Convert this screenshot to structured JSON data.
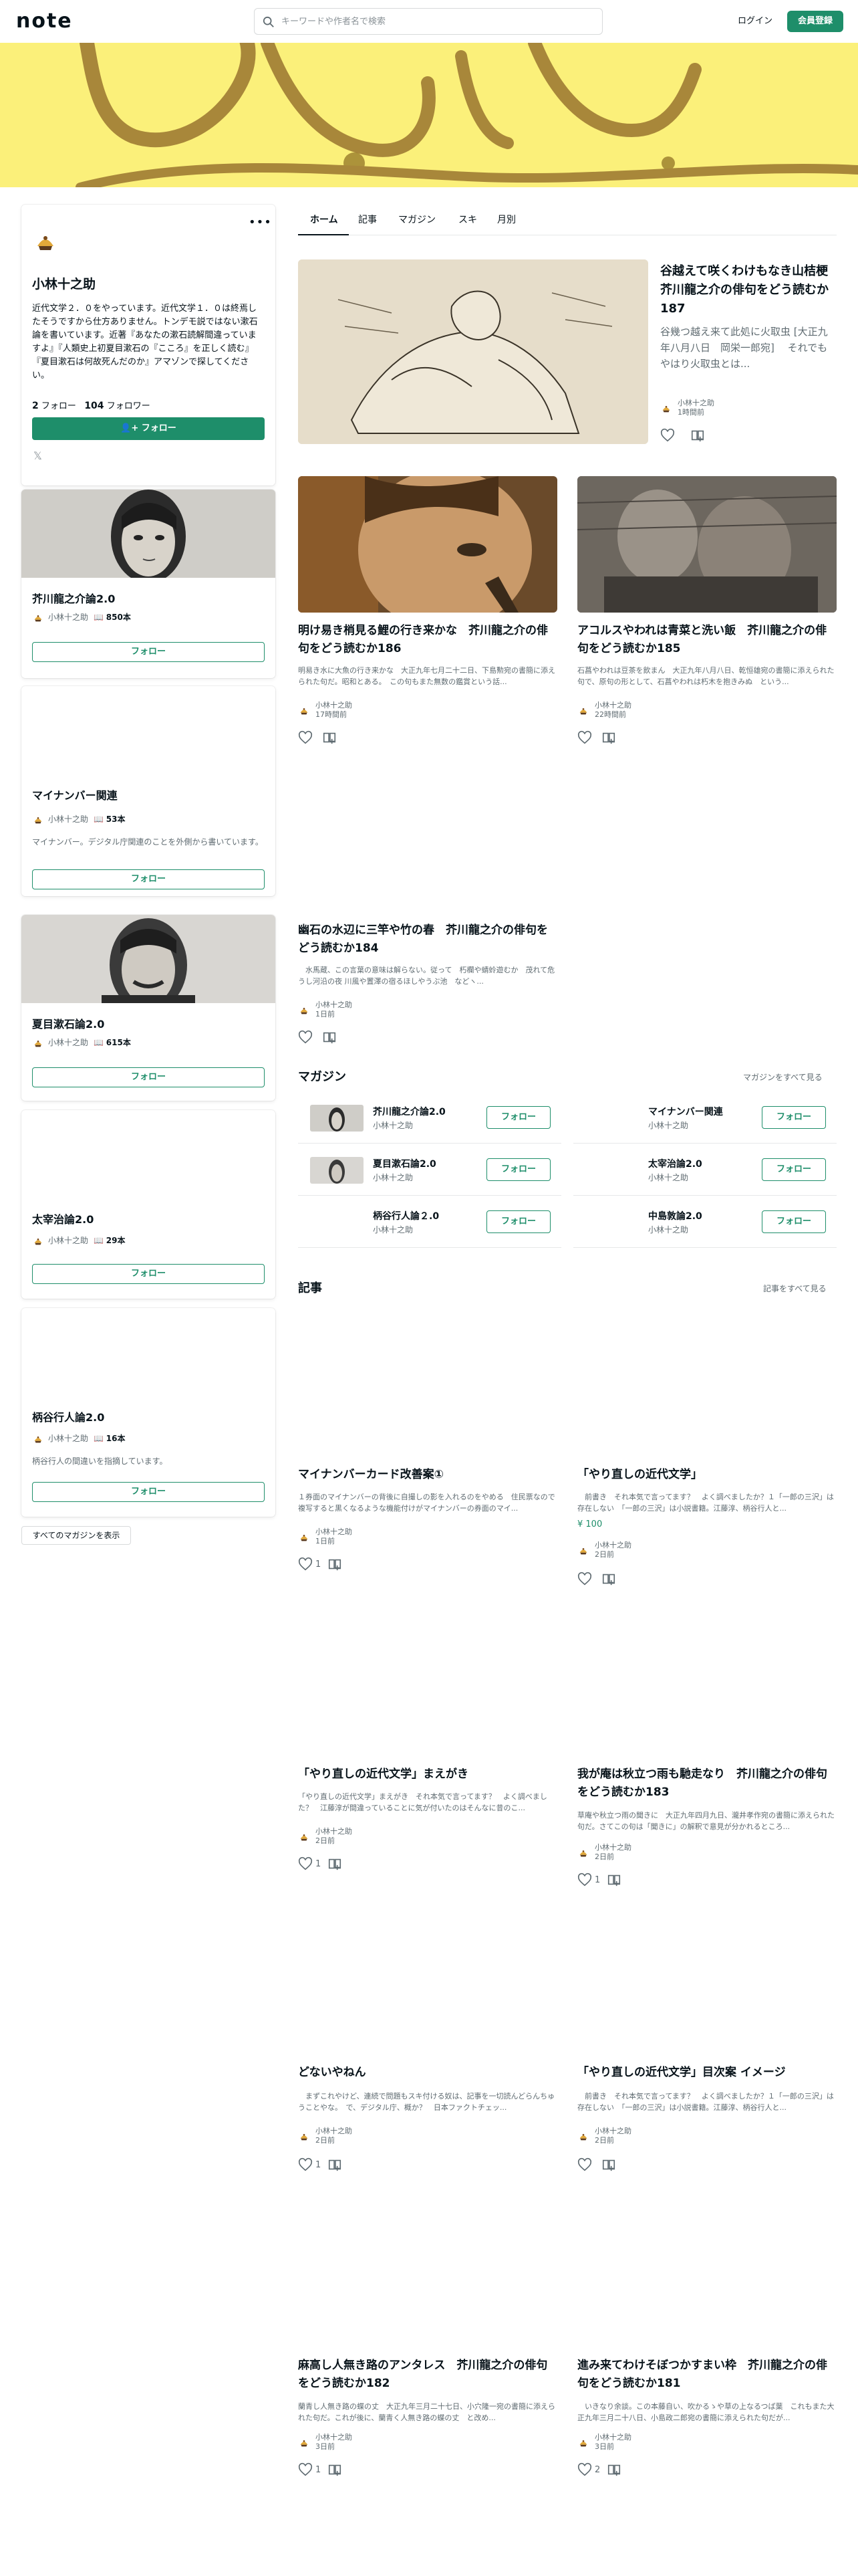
{
  "header": {
    "logo": "note",
    "search_placeholder": "キーワードや作者名で検索",
    "login": "ログイン",
    "signup": "会員登録"
  },
  "profile": {
    "name": "小林十之助",
    "bio": "近代文学２．０をやっています。近代文学１．０は終焉したそうですから仕方ありません。トンデモ説ではない漱石論を書いています。近著『あなたの漱石読解間違っていますよ』『人類史上初夏目漱石の『こころ』を正しく読む』『夏目漱石は何故死んだのか』アマゾンで探してください。",
    "following_count": "2",
    "following_label": "フォロー",
    "followers_count": "104",
    "followers_label": "フォロワー",
    "follow_button": "フォロー"
  },
  "sidebar_magazines": [
    {
      "title": "芥川龍之介論2.0",
      "author": "小林十之助",
      "count": "850本",
      "description": "",
      "follow": "フォロー"
    },
    {
      "title": "マイナンバー関連",
      "author": "小林十之助",
      "count": "53本",
      "description": "マイナンバー。デジタル庁関連のことを外側から書いています。",
      "follow": "フォロー"
    },
    {
      "title": "夏目漱石論2.0",
      "author": "小林十之助",
      "count": "615本",
      "description": "",
      "follow": "フォロー"
    },
    {
      "title": "太宰治論2.0",
      "author": "小林十之助",
      "count": "29本",
      "description": "",
      "follow": "フォロー"
    },
    {
      "title": "柄谷行人論2.0",
      "author": "小林十之助",
      "count": "16本",
      "description": "柄谷行人の間違いを指摘しています。",
      "follow": "フォロー"
    }
  ],
  "all_magazines_button": "すべてのマガジンを表示",
  "tabs": [
    "ホーム",
    "記事",
    "マガジン",
    "スキ",
    "月別"
  ],
  "featured": {
    "title": "谷越えて咲くわけもなき山桔梗　芥川龍之介の俳句をどう読むか187",
    "excerpt": "谷幾つ越え来て此処に火取虫 [大正九年八月八日　岡栄一郎宛] 　それでもやはり火取虫とは...",
    "author": "小林十之助",
    "time": "1時間前"
  },
  "top_articles": [
    {
      "title": "明け易き梢見る鯉の行き来かな　芥川龍之介の俳句をどう読むか186",
      "excerpt": "明易き水に大魚の行き来かな　大正九年七月二十二日、下島勲宛の書簡に添えられた句だ。昭和とある。　この句もまた無数の鑑賞という話...",
      "author": "小林十之助",
      "time": "17時間前"
    },
    {
      "title": "アコルスやわれは青菜と洗い飯　芥川龍之介の俳句をどう読むか185",
      "excerpt": "石菖やわれは豆茶を飲まん　大正九年八月八日、乾恒雄宛の書簡に添えられた句で、原句の形として、石菖やわれは朽木を抱きみぬ　という...",
      "author": "小林十之助",
      "time": "22時間前"
    },
    {
      "title": "幽石の水辺に三竿や竹の春　芥川龍之介の俳句をどう読むか184",
      "excerpt": "　水馬蔵、この言葉の意味は解らない。従って　朽欄や蜻蛉遊むか　茂れて危うし河沿の夜 川風や置澤の宿るほしやうぶ池　などヽ...",
      "author": "小林十之助",
      "time": "1日前"
    }
  ],
  "magazine_section": {
    "title": "マガジン",
    "see_all": "マガジンをすべて見る",
    "items": [
      {
        "name": "芥川龍之介論2.0",
        "author": "小林十之助",
        "follow": "フォロー"
      },
      {
        "name": "マイナンバー関連",
        "author": "小林十之助",
        "follow": "フォロー"
      },
      {
        "name": "夏目漱石論2.0",
        "author": "小林十之助",
        "follow": "フォロー"
      },
      {
        "name": "太宰治論2.0",
        "author": "小林十之助",
        "follow": "フォロー"
      },
      {
        "name": "柄谷行人論２.0",
        "author": "小林十之助",
        "follow": "フォロー"
      },
      {
        "name": "中島敦論2.0",
        "author": "小林十之助",
        "follow": "フォロー"
      }
    ]
  },
  "articles_section": {
    "title": "記事",
    "see_all": "記事をすべて見る",
    "items": [
      {
        "title": "マイナンバーカード改善案①",
        "excerpt": "１券面のマイナンバーの背後に自撮しの影を入れるのをやめる　住民票なので複写すると黒くなるような機能付けがマイナンバーの券面のマイ...",
        "author": "小林十之助",
        "time": "1日前",
        "likes": "1",
        "price": ""
      },
      {
        "title": "「やり直しの近代文学」",
        "excerpt": "　前書き　それ本気で言ってます？　よく調べましたか？１「一郎の三沢」は存在しない　「一郎の三沢」は小説書籍。江藤淳、柄谷行人と...",
        "author": "小林十之助",
        "time": "2日前",
        "likes": "",
        "price": "¥ 100"
      },
      {
        "title": "「やり直しの近代文学」まえがき",
        "excerpt": "「やり直しの近代文学」まえがき　それ本気で言ってます？　よく調べました？　江藤淳が間違っていることに気が付いたのはそんなに昔のこ...",
        "author": "小林十之助",
        "time": "2日前",
        "likes": "1",
        "price": ""
      },
      {
        "title": "我が庵は秋立つ雨も馳走なり　芥川龍之介の俳句をどう読むか183",
        "excerpt": "草庵や秋立つ雨の聞きに　大正九年四月九日、瀧井孝作宛の書簡に添えられた句だ。さてこの句は「聞きに」の解釈で意見が分かれるところ...",
        "author": "小林十之助",
        "time": "2日前",
        "likes": "1",
        "price": ""
      },
      {
        "title": "どないやねん",
        "excerpt": "　まずこれやけど、連続で問題もスキ付ける奴は、記事を一切読んどらんちゅうことやな。　で、デジタル庁、概か？　日本ファクトチェッ...",
        "author": "小林十之助",
        "time": "2日前",
        "likes": "1",
        "price": ""
      },
      {
        "title": "「やり直しの近代文学」目次案 イメージ",
        "excerpt": "　前書き　それ本気で言ってます？　よく調べましたか？１「一郎の三沢」は存在しない　「一郎の三沢」は小説書籍。江藤淳、柄谷行人と...",
        "author": "小林十之助",
        "time": "2日前",
        "likes": "",
        "price": ""
      },
      {
        "title": "麻高し人無き路のアンタレス　芥川龍之介の俳句をどう読むか182",
        "excerpt": "蘭青し人無き路の蝶の丈　大正九年三月二十七日、小穴隆一宛の書簡に添えられた句だ。これが後に、蘭青く人無き路の蝶の丈　と改め...",
        "author": "小林十之助",
        "time": "3日前",
        "likes": "1",
        "price": ""
      },
      {
        "title": "進み来てわけそぼつかすまい枠　芥川龍之介の俳句をどう読むか181",
        "excerpt": "　いきなり余談。この本藤自い、吹かるゝや草の上なるつば葉　これもまた大正九年三月二十八日、小島政二郎宛の書簡に添えられた句だが...",
        "author": "小林十之助",
        "time": "3日前",
        "likes": "2",
        "price": ""
      }
    ]
  },
  "colors": {
    "accent": "#1e8e6a",
    "banner": "#fbf07a",
    "text": "#08131a",
    "muted": "#5f6b71"
  }
}
